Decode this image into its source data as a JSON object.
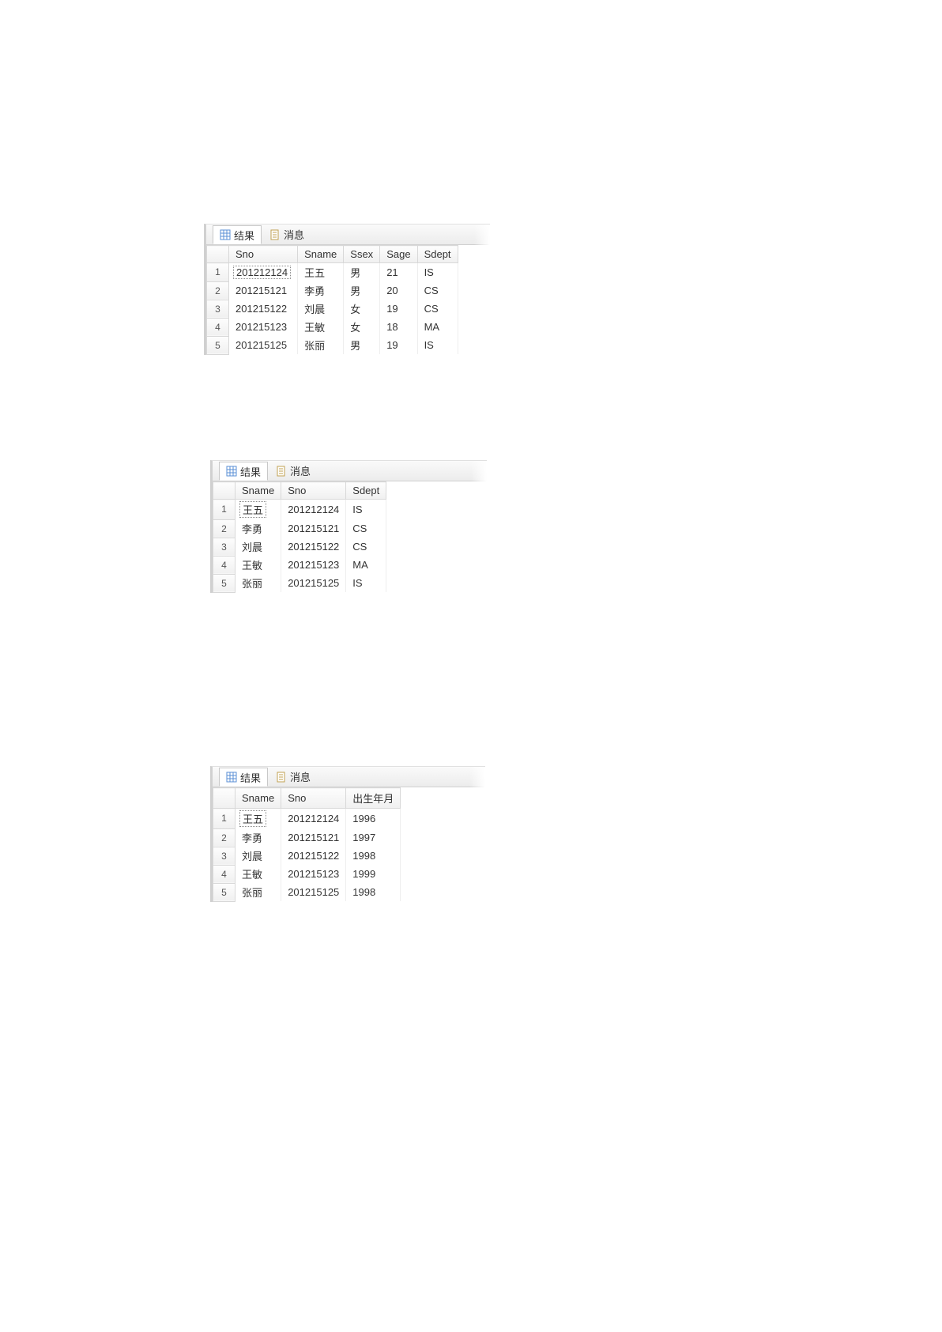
{
  "tabs": {
    "results_label": "结果",
    "messages_label": "消息"
  },
  "panel1": {
    "columns": [
      "Sno",
      "Sname",
      "Ssex",
      "Sage",
      "Sdept"
    ],
    "rows": [
      {
        "n": "1",
        "Sno": "201212124",
        "Sname": "王五",
        "Ssex": "男",
        "Sage": "21",
        "Sdept": "IS"
      },
      {
        "n": "2",
        "Sno": "201215121",
        "Sname": "李勇",
        "Ssex": "男",
        "Sage": "20",
        "Sdept": "CS"
      },
      {
        "n": "3",
        "Sno": "201215122",
        "Sname": "刘晨",
        "Ssex": "女",
        "Sage": "19",
        "Sdept": "CS"
      },
      {
        "n": "4",
        "Sno": "201215123",
        "Sname": "王敏",
        "Ssex": "女",
        "Sage": "18",
        "Sdept": "MA"
      },
      {
        "n": "5",
        "Sno": "201215125",
        "Sname": "张丽",
        "Ssex": "男",
        "Sage": "19",
        "Sdept": "IS"
      }
    ]
  },
  "panel2": {
    "columns": [
      "Sname",
      "Sno",
      "Sdept"
    ],
    "rows": [
      {
        "n": "1",
        "Sname": "王五",
        "Sno": "201212124",
        "Sdept": "IS"
      },
      {
        "n": "2",
        "Sname": "李勇",
        "Sno": "201215121",
        "Sdept": "CS"
      },
      {
        "n": "3",
        "Sname": "刘晨",
        "Sno": "201215122",
        "Sdept": "CS"
      },
      {
        "n": "4",
        "Sname": "王敏",
        "Sno": "201215123",
        "Sdept": "MA"
      },
      {
        "n": "5",
        "Sname": "张丽",
        "Sno": "201215125",
        "Sdept": "IS"
      }
    ]
  },
  "panel3": {
    "columns": [
      "Sname",
      "Sno",
      "出生年月"
    ],
    "rows": [
      {
        "n": "1",
        "Sname": "王五",
        "Sno": "201212124",
        "birth": "1996"
      },
      {
        "n": "2",
        "Sname": "李勇",
        "Sno": "201215121",
        "birth": "1997"
      },
      {
        "n": "3",
        "Sname": "刘晨",
        "Sno": "201215122",
        "birth": "1998"
      },
      {
        "n": "4",
        "Sname": "王敏",
        "Sno": "201215123",
        "birth": "1999"
      },
      {
        "n": "5",
        "Sname": "张丽",
        "Sno": "201215125",
        "birth": "1998"
      }
    ]
  }
}
